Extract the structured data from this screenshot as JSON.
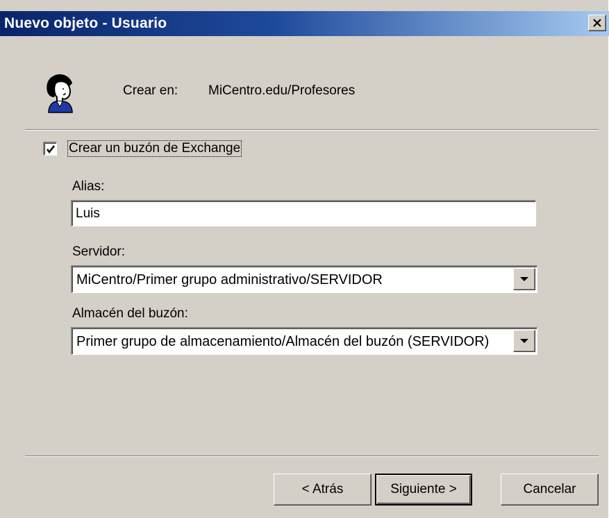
{
  "window": {
    "title": "Nuevo objeto - Usuario",
    "close_glyph": "×"
  },
  "header": {
    "icon": "user-icon",
    "create_in_label": "Crear en:",
    "create_in_path": "MiCentro.edu/Profesores"
  },
  "mailbox": {
    "checked": true,
    "label": "Crear un buzón de Exchange"
  },
  "alias": {
    "label": "Alias:",
    "value": "Luis"
  },
  "server": {
    "label": "Servidor:",
    "value": "MiCentro/Primer grupo administrativo/SERVIDOR"
  },
  "store": {
    "label": "Almacén del buzón:",
    "value": "Primer grupo de almacenamiento/Almacén del buzón (SERVIDOR)"
  },
  "buttons": {
    "back": "< Atrás",
    "next": "Siguiente >",
    "cancel": "Cancelar"
  },
  "colors": {
    "titlebar_start": "#0a246a",
    "titlebar_end": "#a6caf0",
    "face": "#d4d0c8"
  }
}
